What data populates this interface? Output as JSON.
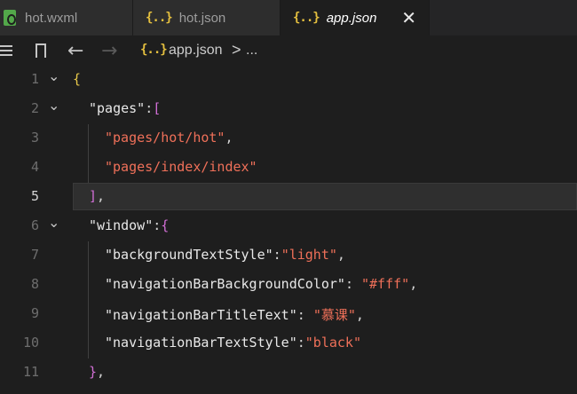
{
  "tabs": [
    {
      "label": "hot.wxml"
    },
    {
      "label": "hot.json"
    },
    {
      "label": "app.json",
      "close": "✕"
    }
  ],
  "icons": {
    "json": "{..}"
  },
  "breadcrumb": {
    "file": "app.json",
    "separator": ">",
    "more": "..."
  },
  "editor": {
    "current_line": 5,
    "lines": [
      {
        "n": "1",
        "tokens": [
          {
            "t": "{",
            "c": "t-brace"
          }
        ]
      },
      {
        "n": "2",
        "tokens": [
          {
            "t": "\"pages\"",
            "c": "t-key"
          },
          {
            "t": ":",
            "c": "t-punct"
          },
          {
            "t": "[",
            "c": "t-bracket"
          }
        ]
      },
      {
        "n": "3",
        "tokens": [
          {
            "t": "\"pages/hot/hot\"",
            "c": "t-str"
          },
          {
            "t": ",",
            "c": "t-punct"
          }
        ]
      },
      {
        "n": "4",
        "tokens": [
          {
            "t": "\"pages/index/index\"",
            "c": "t-str"
          }
        ]
      },
      {
        "n": "5",
        "tokens": [
          {
            "t": "]",
            "c": "t-bracket"
          },
          {
            "t": ",",
            "c": "t-punct"
          }
        ]
      },
      {
        "n": "6",
        "tokens": [
          {
            "t": "\"window\"",
            "c": "t-key"
          },
          {
            "t": ":",
            "c": "t-punct"
          },
          {
            "t": "{",
            "c": "t-bracket"
          }
        ]
      },
      {
        "n": "7",
        "tokens": [
          {
            "t": "\"backgroundTextStyle\"",
            "c": "t-key"
          },
          {
            "t": ":",
            "c": "t-punct"
          },
          {
            "t": "\"light\"",
            "c": "t-str"
          },
          {
            "t": ",",
            "c": "t-punct"
          }
        ]
      },
      {
        "n": "8",
        "tokens": [
          {
            "t": "\"navigationBarBackgroundColor\"",
            "c": "t-key"
          },
          {
            "t": ": ",
            "c": "t-punct"
          },
          {
            "t": "\"#fff\"",
            "c": "t-str"
          },
          {
            "t": ",",
            "c": "t-punct"
          }
        ]
      },
      {
        "n": "9",
        "tokens": [
          {
            "t": "\"navigationBarTitleText\"",
            "c": "t-key"
          },
          {
            "t": ": ",
            "c": "t-punct"
          },
          {
            "t": "\"慕课\"",
            "c": "t-str"
          },
          {
            "t": ",",
            "c": "t-punct"
          }
        ]
      },
      {
        "n": "10",
        "tokens": [
          {
            "t": "\"navigationBarTextStyle\"",
            "c": "t-key"
          },
          {
            "t": ":",
            "c": "t-punct"
          },
          {
            "t": "\"black\"",
            "c": "t-str"
          }
        ]
      },
      {
        "n": "11",
        "tokens": [
          {
            "t": "}",
            "c": "t-bracket"
          },
          {
            "t": ",",
            "c": "t-punct"
          }
        ]
      }
    ]
  }
}
